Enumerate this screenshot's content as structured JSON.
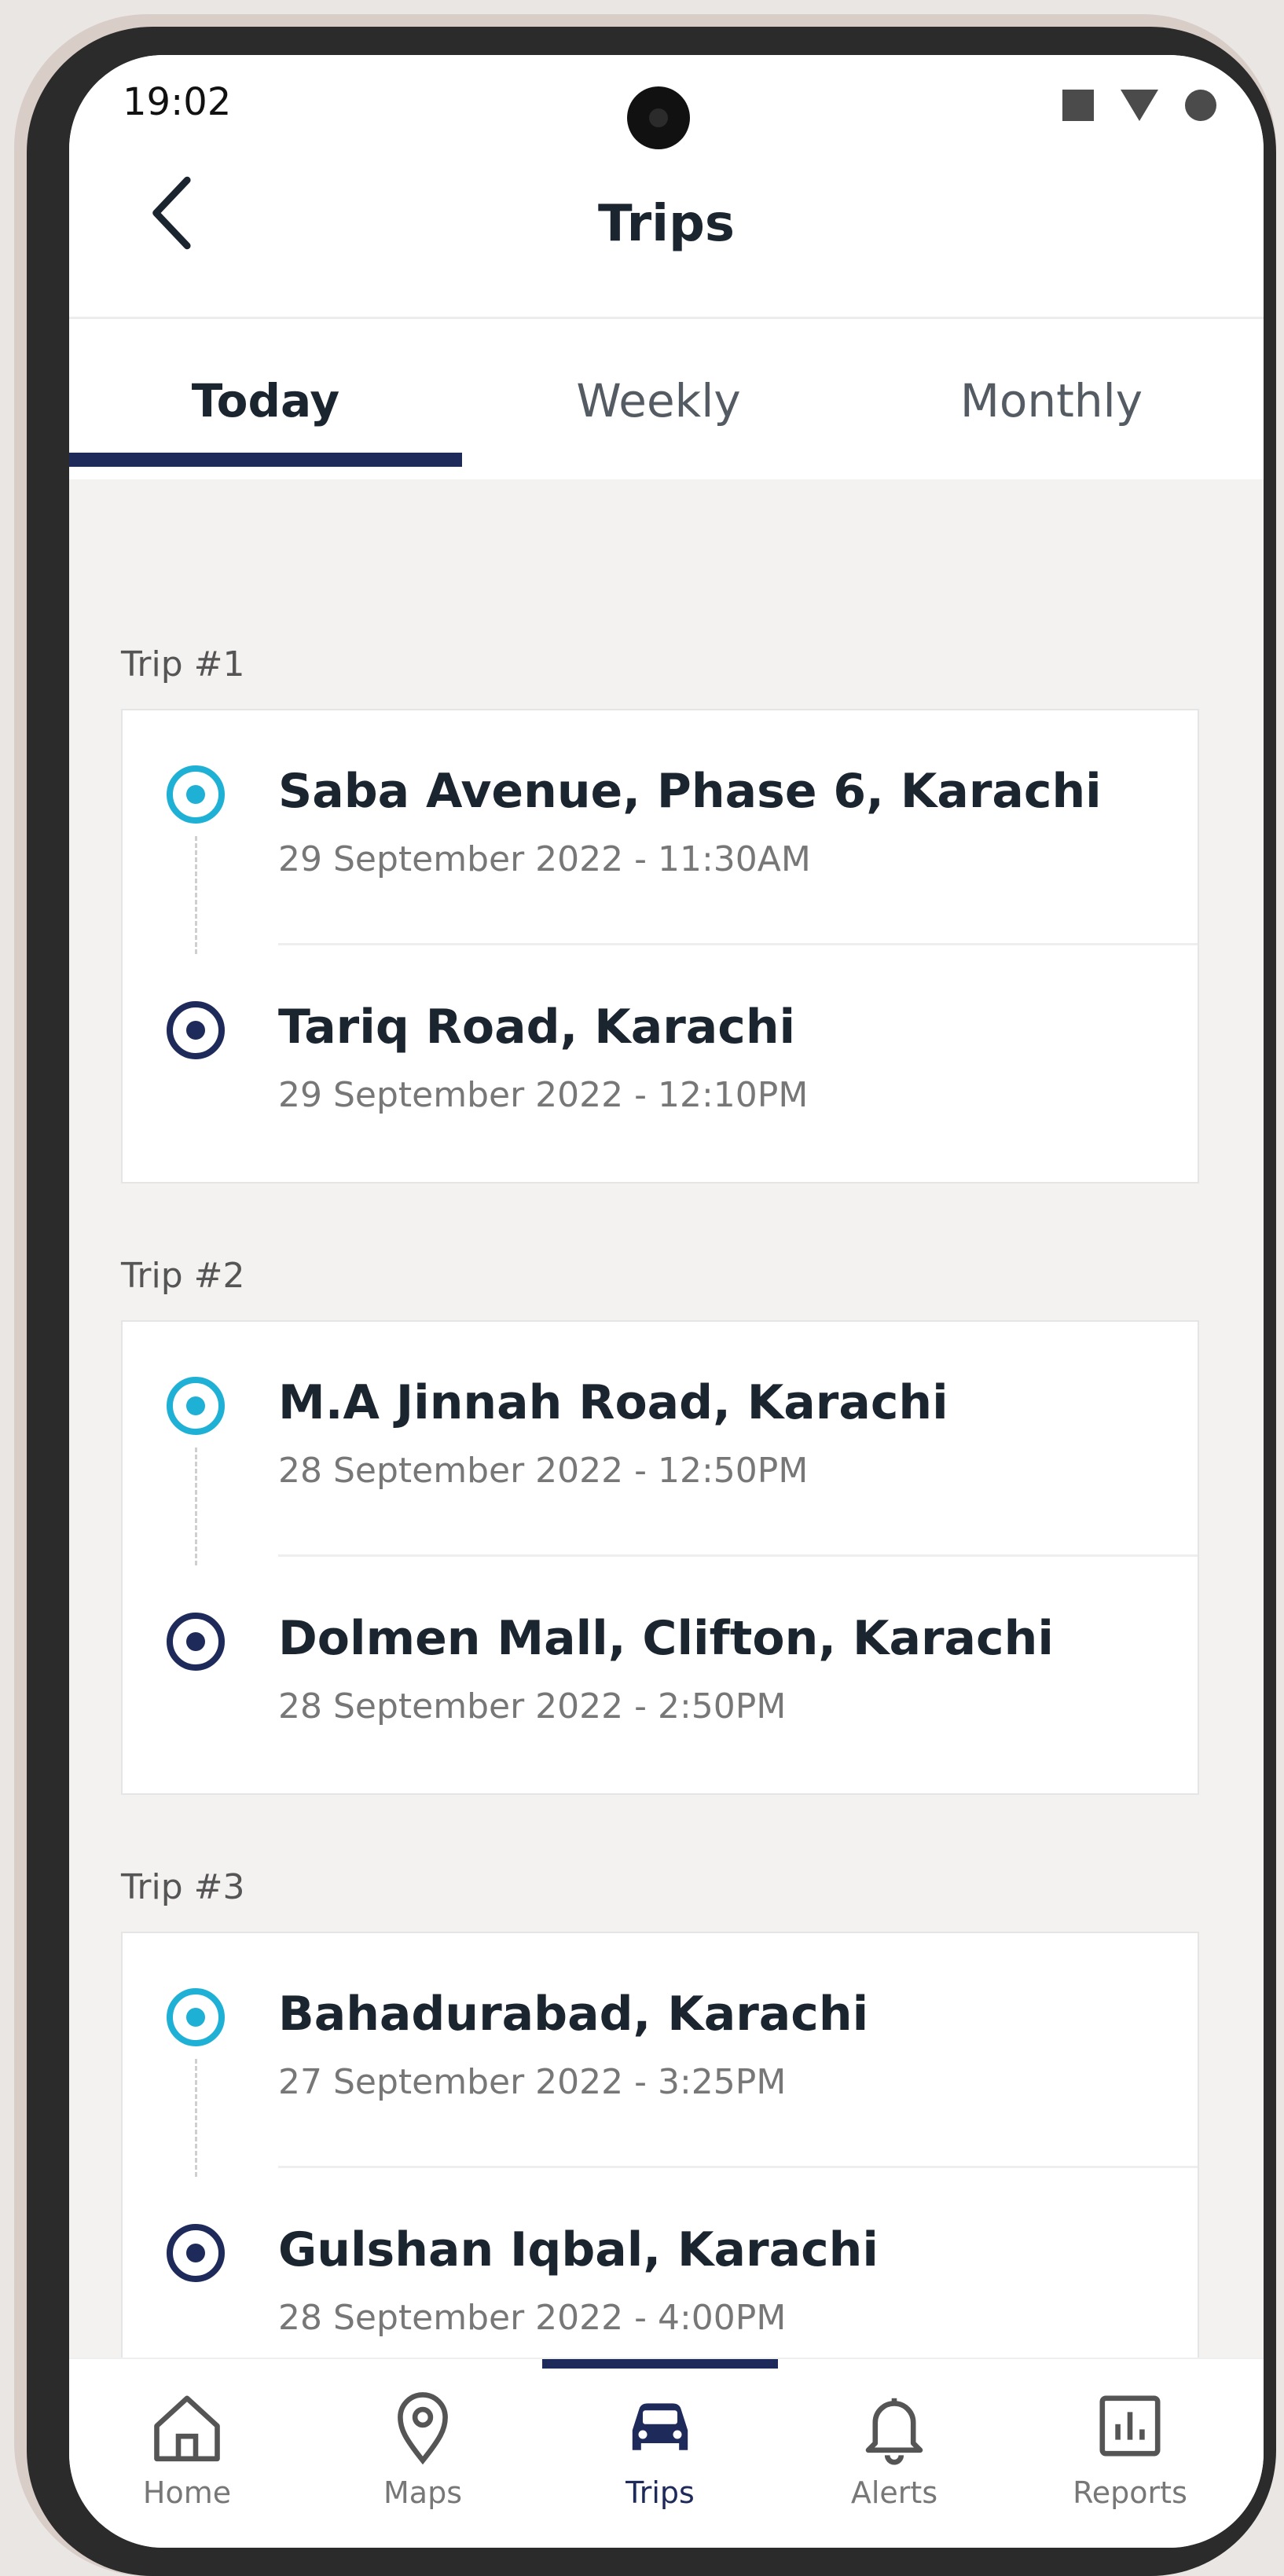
{
  "status": {
    "time": "19:02"
  },
  "header": {
    "title": "Trips"
  },
  "tabs": [
    {
      "label": "Today"
    },
    {
      "label": "Weekly"
    },
    {
      "label": "Monthly"
    }
  ],
  "active_tab": "Today",
  "trips": [
    {
      "label": "Trip #1",
      "from": {
        "place": "Saba Avenue, Phase 6, Karachi",
        "time": "29 September 2022 - 11:30AM"
      },
      "to": {
        "place": "Tariq Road, Karachi",
        "time": "29 September 2022 - 12:10PM"
      }
    },
    {
      "label": "Trip #2",
      "from": {
        "place": "M.A Jinnah Road, Karachi",
        "time": "28 September 2022 - 12:50PM"
      },
      "to": {
        "place": "Dolmen Mall, Clifton, Karachi",
        "time": "28 September 2022 - 2:50PM"
      }
    },
    {
      "label": "Trip #3",
      "from": {
        "place": "Bahadurabad, Karachi",
        "time": "27 September 2022 - 3:25PM"
      },
      "to": {
        "place": "Gulshan Iqbal, Karachi",
        "time": "28 September 2022 - 4:00PM"
      }
    }
  ],
  "bottom_nav": [
    {
      "label": "Home",
      "icon": "home-icon"
    },
    {
      "label": "Maps",
      "icon": "map-pin-icon"
    },
    {
      "label": "Trips",
      "icon": "car-icon"
    },
    {
      "label": "Alerts",
      "icon": "bell-icon"
    },
    {
      "label": "Reports",
      "icon": "bar-chart-icon"
    }
  ],
  "active_nav": "Trips",
  "colors": {
    "accent": "#1D2A5A",
    "start_pin": "#1FB0D6",
    "end_pin": "#1D2A5A"
  }
}
